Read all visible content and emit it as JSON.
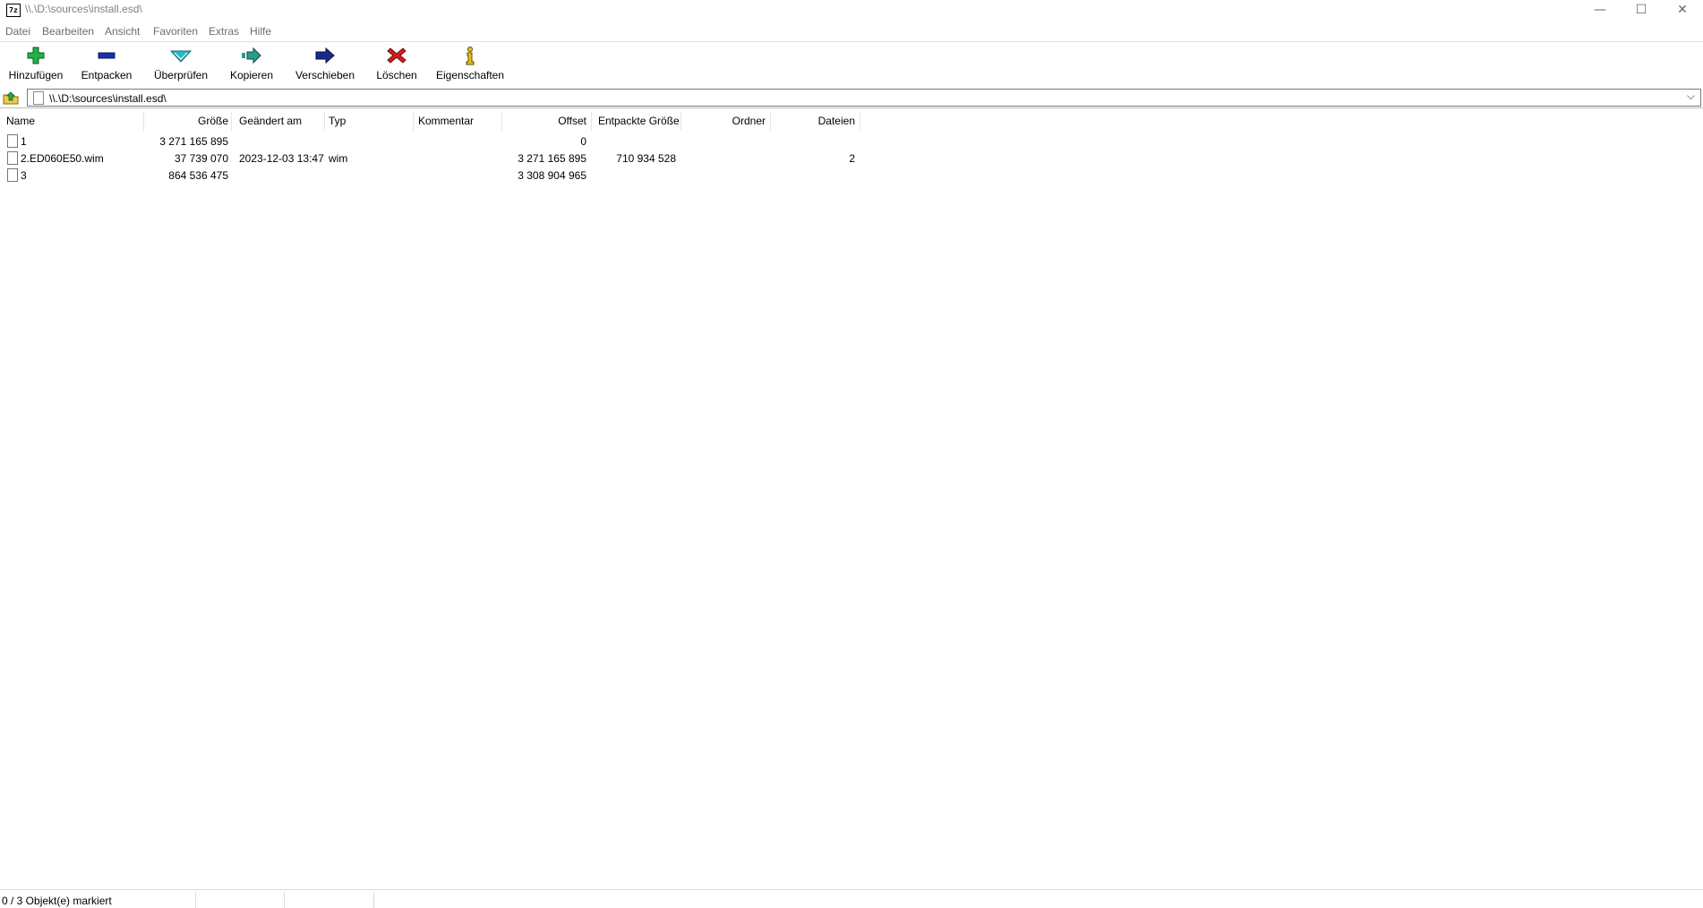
{
  "window": {
    "title": "\\\\.\\D:\\sources\\install.esd\\",
    "app_icon_text": "7z",
    "minimize_glyph": "—",
    "maximize_glyph": "☐",
    "close_glyph": "✕"
  },
  "menu": [
    "Datei",
    "Bearbeiten",
    "Ansicht",
    "Favoriten",
    "Extras",
    "Hilfe"
  ],
  "toolbar": {
    "add_label": "Hinzufügen",
    "extract_label": "Entpacken",
    "test_label": "Überprüfen",
    "copy_label": "Kopieren",
    "move_label": "Verschieben",
    "delete_label": "Löschen",
    "info_label": "Eigenschaften"
  },
  "address": {
    "path": "\\\\.\\D:\\sources\\install.esd\\",
    "dropdown_glyph": "⌵"
  },
  "columns": {
    "name": "Name",
    "size": "Größe",
    "modified": "Geändert am",
    "type": "Typ",
    "comment": "Kommentar",
    "offset": "Offset",
    "unpacked": "Entpackte Größe",
    "folders": "Ordner",
    "files": "Dateien"
  },
  "rows": [
    {
      "name": "1",
      "size": "3 271 165 895",
      "modified": "",
      "type": "",
      "comment": "",
      "offset": "0",
      "unpacked": "",
      "folders": "",
      "files": ""
    },
    {
      "name": "2.ED060E50.wim",
      "size": "37 739 070",
      "modified": "2023-12-03 13:47",
      "type": "wim",
      "comment": "",
      "offset": "3 271 165 895",
      "unpacked": "710 934 528",
      "folders": "",
      "files": "2"
    },
    {
      "name": "3",
      "size": "864 536 475",
      "modified": "",
      "type": "",
      "comment": "",
      "offset": "3 308 904 965",
      "unpacked": "",
      "folders": "",
      "files": ""
    }
  ],
  "status": {
    "selected": "0 / 3 Objekt(e) markiert"
  },
  "colors": {
    "add": "#22b14c",
    "extract": "#1b2fa8",
    "test": "#2ab7c6",
    "copy": "#2a9c8e",
    "move": "#1a2a8a",
    "delete": "#d21e1e",
    "info": "#e8c21a"
  }
}
